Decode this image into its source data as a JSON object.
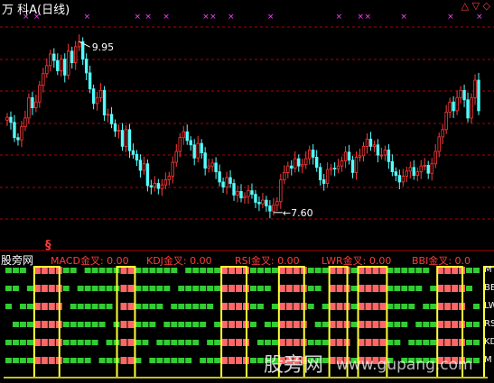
{
  "top_title": {
    "title": "万 科A",
    "period": "(日线)"
  },
  "indicator_panel": {
    "name": "股旁网",
    "marker": "§",
    "labels": [
      {
        "text": "MACD金叉: 0.00"
      },
      {
        "text": "KDJ金叉: 0.00"
      },
      {
        "text": "RSI金叉: 0.00"
      },
      {
        "text": "LWR金叉: 0.00"
      },
      {
        "text": "BBI金叉: 0.0"
      }
    ],
    "row_right_labels": [
      "M",
      "BE",
      "LW",
      "RS",
      "KD",
      "M"
    ]
  },
  "watermark": {
    "brand": "股旁网",
    "url": "www.gupang.com"
  },
  "colors": {
    "background": "#000000",
    "up_candle": "#ff3b3b",
    "down_candle": "#54ffff",
    "grid": "#b00000",
    "cross_marker": "#ff44ff",
    "green_bar": "#33cc33",
    "red_bar": "#ff6666",
    "yellow_line": "#ffff33",
    "label_red": "#ff3b3b"
  },
  "chart_data": [
    {
      "type": "candlestick",
      "title": "万 科A (日线)",
      "ylim": [
        7.3,
        10.3
      ],
      "annotations": [
        {
          "label": "9.95",
          "kind": "high",
          "index": 20,
          "value": 9.95
        },
        {
          "label": "7.60",
          "kind": "low",
          "index": 74,
          "value": 7.6
        }
      ],
      "gold_cross_marker_indices": [
        5,
        8,
        22,
        36,
        39,
        44,
        55,
        57,
        62,
        73,
        92,
        98,
        100,
        110,
        123,
        131
      ],
      "close": [
        8.91,
        8.84,
        8.63,
        8.6,
        8.78,
        8.9,
        9.18,
        9.04,
        9.12,
        9.35,
        9.51,
        9.62,
        9.78,
        9.69,
        9.55,
        9.71,
        9.49,
        9.82,
        9.66,
        9.88,
        9.95,
        9.71,
        9.52,
        9.3,
        9.1,
        9.18,
        9.28,
        8.94,
        8.95,
        8.82,
        8.72,
        8.73,
        8.51,
        8.74,
        8.45,
        8.4,
        8.32,
        8.18,
        8.27,
        7.97,
        7.95,
        8.0,
        7.93,
        7.98,
        8.05,
        8.1,
        8.29,
        8.44,
        8.63,
        8.71,
        8.59,
        8.53,
        8.35,
        8.55,
        8.42,
        8.21,
        8.24,
        8.28,
        8.16,
        8.02,
        7.95,
        8.08,
        8.0,
        7.84,
        7.89,
        7.8,
        7.82,
        7.9,
        7.85,
        7.74,
        7.72,
        7.77,
        7.69,
        7.62,
        7.7,
        7.75,
        8.05,
        8.15,
        8.24,
        8.21,
        8.34,
        8.24,
        8.26,
        8.34,
        8.46,
        8.36,
        8.22,
        8.05,
        8.0,
        8.19,
        8.21,
        8.2,
        8.24,
        8.31,
        8.43,
        8.32,
        8.15,
        8.36,
        8.38,
        8.51,
        8.61,
        8.51,
        8.53,
        8.39,
        8.39,
        8.46,
        8.3,
        8.16,
        8.11,
        8.02,
        8.1,
        8.17,
        8.22,
        8.11,
        8.16,
        8.24,
        8.25,
        8.14,
        8.27,
        8.44,
        8.64,
        8.74,
        8.98,
        9.12,
        9.0,
        9.18,
        9.28,
        9.15,
        8.9,
        9.18,
        9.42,
        9.0
      ]
    },
    {
      "type": "indicator_grid",
      "series": [
        {
          "name": "MACD金叉",
          "value": 0.0
        },
        {
          "name": "KDJ金叉",
          "value": 0.0
        },
        {
          "name": "RSI金叉",
          "value": 0.0
        },
        {
          "name": "LWR金叉",
          "value": 0.0
        },
        {
          "name": "BBI金叉",
          "value": 0.0
        }
      ],
      "rows": [
        "M",
        "BBI",
        "LWR",
        "RSI",
        "KDJ",
        "MACD"
      ],
      "signal_bands": [
        [
          8,
          14
        ],
        [
          31,
          35
        ],
        [
          60,
          66
        ],
        [
          76,
          82
        ],
        [
          90,
          94
        ],
        [
          98,
          105
        ],
        [
          120,
          126
        ],
        [
          133,
          138
        ]
      ]
    }
  ]
}
